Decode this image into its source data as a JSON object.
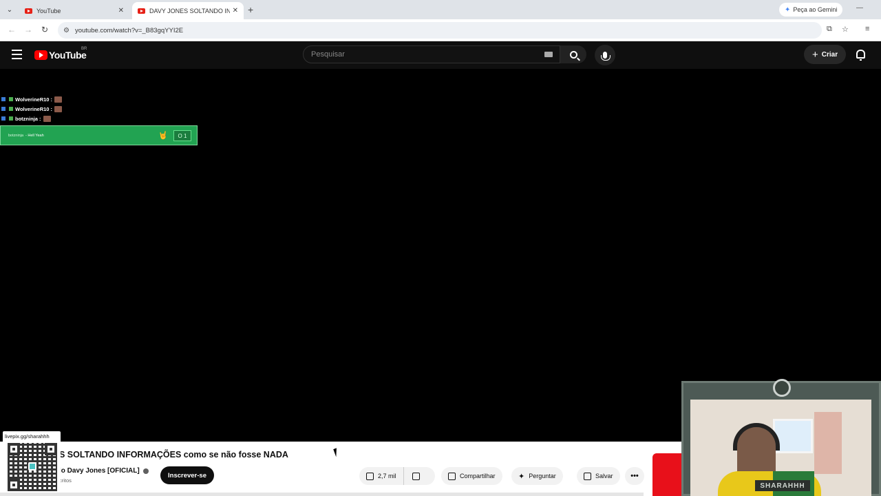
{
  "browser": {
    "tabs": [
      {
        "title": "YouTube",
        "active": false
      },
      {
        "title": "DAVY JONES SOLTANDO INFOR",
        "active": true
      }
    ],
    "new_tab": "+",
    "gemini_label": "Peça ao Gemini",
    "url": "youtube.com/watch?v=_B83gqYYI2E"
  },
  "youtube": {
    "logo_text": "YouTube",
    "country": "BR",
    "search_placeholder": "Pesquisar",
    "create_label": "Criar"
  },
  "overlay": {
    "chat": [
      {
        "user": "WolverineR10 :"
      },
      {
        "user": "WolverineR10 :"
      },
      {
        "user": "botzninja :"
      }
    ],
    "alert": {
      "user": "botzninja",
      "message": "- Hell Yeah",
      "count": "O 1"
    },
    "qr_label": "livepix.gg/sharahhh",
    "cam_name": "SHARAHHH"
  },
  "video": {
    "title": "S SOLTANDO INFORMAÇÕES como se não fosse NADA",
    "channel": "lo Davy Jones [OFICIAL]",
    "subs": "critos",
    "subscribe_label": "Inscrever-se",
    "likes": "2,7 mil",
    "share_label": "Compartilhar",
    "ask_label": "Perguntar",
    "save_label": "Salvar",
    "more_label": "•••"
  },
  "colors": {
    "yt_red": "#ff0000",
    "alert_green": "#22a352",
    "header_bg": "#0f0f0f"
  }
}
